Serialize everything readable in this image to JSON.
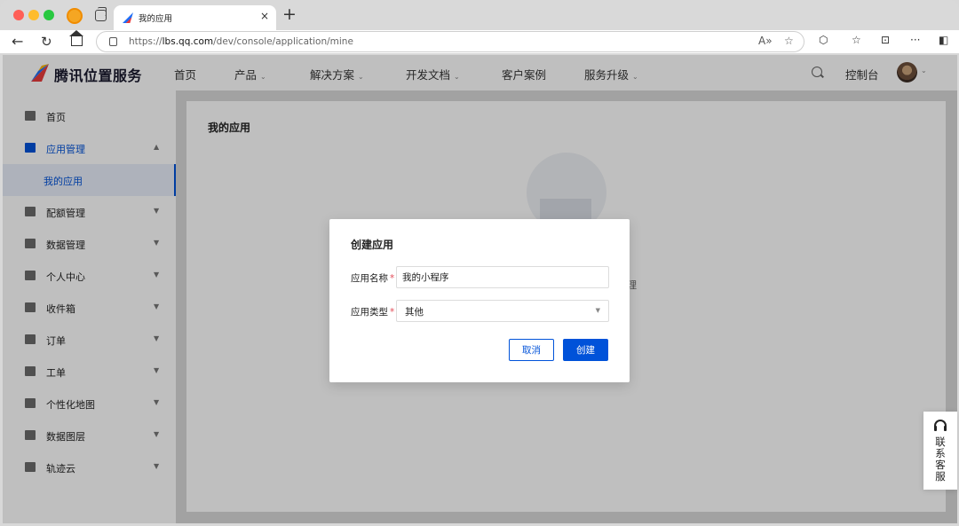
{
  "browser": {
    "tab_title": "我的应用",
    "tab_close": "×",
    "new_tab": "+",
    "url_scheme": "https://",
    "url_host": "lbs.qq.com",
    "url_path": "/dev/console/application/mine",
    "icons": [
      "back-arrow-icon",
      "reload-icon",
      "home-icon",
      "lock-icon",
      "read-aloud-icon",
      "favorite-star-icon",
      "extensions-icon",
      "favorites-icon",
      "screenshot-icon",
      "more-icon",
      "sidebar-toggle-icon"
    ]
  },
  "header": {
    "logo": "腾讯位置服务",
    "nav": [
      {
        "label": "首页",
        "has_caret": false
      },
      {
        "label": "产品",
        "has_caret": true
      },
      {
        "label": "解决方案",
        "has_caret": true
      },
      {
        "label": "开发文档",
        "has_caret": true
      },
      {
        "label": "客户案例",
        "has_caret": false
      },
      {
        "label": "服务升级",
        "has_caret": true
      }
    ],
    "console": "控制台",
    "caret": "⌄"
  },
  "sidebar": {
    "items": [
      {
        "label": "首页",
        "icon": "list-icon"
      },
      {
        "label": "应用管理",
        "icon": "grid-icon",
        "expanded": true
      },
      {
        "label": "我的应用",
        "sub": true,
        "active": true
      },
      {
        "label": "配额管理",
        "icon": "chart-icon"
      },
      {
        "label": "数据管理",
        "icon": "database-icon"
      },
      {
        "label": "个人中心",
        "icon": "user-icon"
      },
      {
        "label": "收件箱",
        "icon": "mail-icon"
      },
      {
        "label": "订单",
        "icon": "clipboard-icon"
      },
      {
        "label": "工单",
        "icon": "ticket-icon"
      },
      {
        "label": "个性化地图",
        "icon": "map-icon"
      },
      {
        "label": "数据图层",
        "icon": "layers-icon"
      },
      {
        "label": "轨迹云",
        "icon": "track-icon"
      }
    ],
    "caret_down": "▼",
    "caret_up": "▲"
  },
  "main": {
    "title": "我的应用",
    "behind_text": "理"
  },
  "modal": {
    "title": "创建应用",
    "name_label": "应用名称",
    "name_value": "我的小程序",
    "type_label": "应用类型",
    "type_value": "其他",
    "required_mark": "*",
    "cancel": "取消",
    "create": "创建",
    "select_caret": "▼"
  },
  "support": {
    "label": "联系客服"
  },
  "colors": {
    "primary": "#0052d9",
    "required": "#e34d59"
  }
}
